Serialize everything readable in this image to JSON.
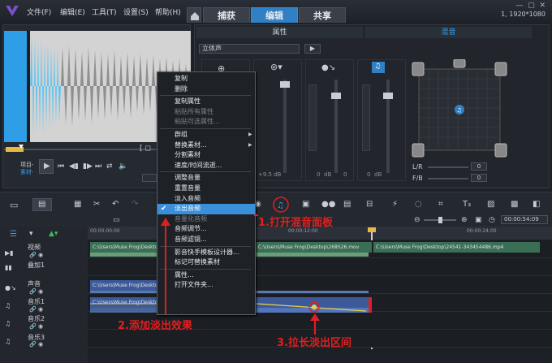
{
  "menu": [
    "文件(F)",
    "编辑(E)",
    "工具(T)",
    "设置(S)",
    "帮助(H)"
  ],
  "modes": [
    "捕获",
    "编辑",
    "共享"
  ],
  "resolution": "1, 1920*1080",
  "props_tabs": [
    "属性",
    "混音"
  ],
  "stereo_select": "立体声",
  "meter_values": [
    "+9.5",
    "0",
    "0",
    "0"
  ],
  "meter_unit": "dB",
  "lr_label": "L/R",
  "fb_label": "F/B",
  "lr_value": "0",
  "fb_value": "0",
  "player": {
    "project_label": "项目-",
    "clip_label": "素材-"
  },
  "timecode": "00:00:54:09",
  "ruler_ticks": [
    "00:00:00:00",
    "00:00:12:00",
    "00:00:24:00"
  ],
  "tracks": [
    "视频",
    "叠加1",
    "声音",
    "音乐1",
    "音乐2",
    "音乐3"
  ],
  "clips": {
    "video1": "C:\\Users\\Muse Frog\\Desktop\\",
    "video2": "C:\\Users\\Muse Frog\\Desktop\\268526.mov",
    "video3": "C:\\Users\\Muse Frog\\Desktop\\24541-343454486.mp4",
    "voice": "C:\\Users\\Muse Frog\\Desktop",
    "music1": "C:\\Users\\Muse Frog\\Desktop"
  },
  "context_menu": [
    {
      "label": "复制",
      "disabled": false
    },
    {
      "label": "删除",
      "disabled": false
    },
    {
      "label": "复制属性",
      "disabled": false
    },
    {
      "label": "粘贴所有属性",
      "disabled": true
    },
    {
      "label": "粘贴可选属性...",
      "disabled": true
    },
    {
      "label": "群组",
      "disabled": false,
      "submenu": true
    },
    {
      "label": "替换素材...",
      "disabled": false,
      "submenu": true
    },
    {
      "label": "分割素材",
      "disabled": false
    },
    {
      "label": "速度/时间流逝...",
      "disabled": false
    },
    {
      "label": "调整音量",
      "disabled": false
    },
    {
      "label": "重置音量",
      "disabled": false
    },
    {
      "label": "淡入音频",
      "disabled": false
    },
    {
      "label": "淡出音频",
      "disabled": false,
      "checked": true,
      "selected": true
    },
    {
      "label": "音量化音频",
      "disabled": true
    },
    {
      "label": "音频调节...",
      "disabled": false
    },
    {
      "label": "音频滤镜...",
      "disabled": false
    },
    {
      "label": "影音快手模板设计器...",
      "disabled": false
    },
    {
      "label": "标记可替换素材",
      "disabled": false
    },
    {
      "label": "属性...",
      "disabled": false
    },
    {
      "label": "打开文件夹...",
      "disabled": false
    }
  ],
  "annotations": [
    "1.打开混音面板",
    "2.添加淡出效果",
    "3.拉长淡出区间"
  ],
  "colors": {
    "accent": "#2f80c4",
    "annotation": "#e02020",
    "video_clip": "#3a6f55",
    "audio_clip": "#3c5a9a",
    "waveform": "#5fc4f0"
  }
}
